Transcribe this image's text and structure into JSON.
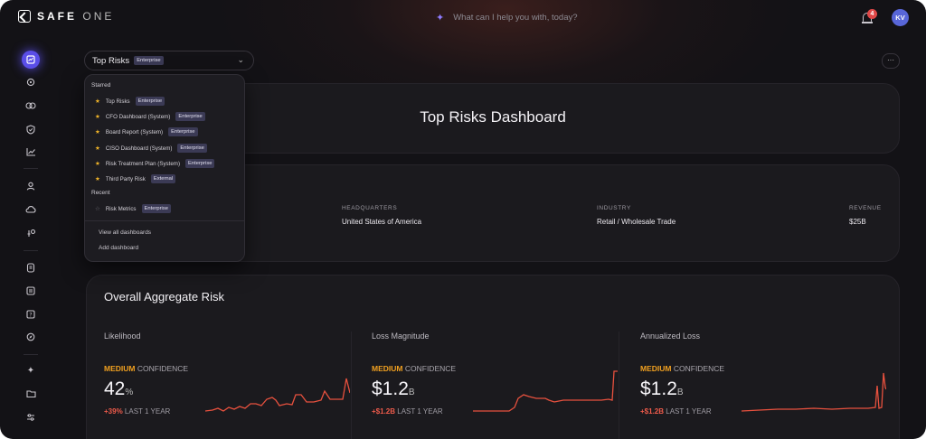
{
  "app": {
    "logo_brand": "SAFE",
    "logo_suffix": "ONE"
  },
  "search": {
    "placeholder": "What can I help you with, today?"
  },
  "notifications": {
    "count": "4"
  },
  "user": {
    "initials": "KV"
  },
  "selector": {
    "title": "Top Risks",
    "tag": "Enterprise"
  },
  "dropdown": {
    "starred_label": "Starred",
    "starred": [
      {
        "name": "Top Risks",
        "tag": "Enterprise"
      },
      {
        "name": "CFO Dashboard (System)",
        "tag": "Enterprise"
      },
      {
        "name": "Board Report (System)",
        "tag": "Enterprise"
      },
      {
        "name": "CISO Dashboard (System)",
        "tag": "Enterprise"
      },
      {
        "name": "Risk Treatment Plan (System)",
        "tag": "Enterprise"
      },
      {
        "name": "Third Party Risk",
        "tag": "External"
      }
    ],
    "recent_label": "Recent",
    "recent": [
      {
        "name": "Risk Metrics",
        "tag": "Enterprise"
      }
    ],
    "view_all": "View all dashboards",
    "add": "Add dashboard"
  },
  "dashboard": {
    "title": "Top Risks Dashboard",
    "more": "···"
  },
  "company": {
    "headquarters_label": "HEADQUARTERS",
    "headquarters": "United States of America",
    "industry_label": "INDUSTRY",
    "industry": "Retail / Wholesale Trade",
    "revenue_label": "REVENUE",
    "revenue": "$25B"
  },
  "risk": {
    "title": "Overall Aggregate Risk",
    "metrics": [
      {
        "label": "Likelihood",
        "level": "MEDIUM",
        "conf": "CONFIDENCE",
        "value": "42",
        "unit": "%",
        "delta": "+39%",
        "period": "LAST 1 YEAR"
      },
      {
        "label": "Loss Magnitude",
        "level": "MEDIUM",
        "conf": "CONFIDENCE",
        "value": "$1.2",
        "unit": "B",
        "delta": "+$1.2B",
        "period": "LAST 1 YEAR"
      },
      {
        "label": "Annualized Loss",
        "level": "MEDIUM",
        "conf": "CONFIDENCE",
        "value": "$1.2",
        "unit": "B",
        "delta": "+$1.2B",
        "period": "LAST 1 YEAR"
      }
    ]
  },
  "colors": {
    "accent": "#5a4ee8",
    "medium": "#f0a020",
    "increase": "#ef5b4b",
    "spark": "#e8513e"
  }
}
